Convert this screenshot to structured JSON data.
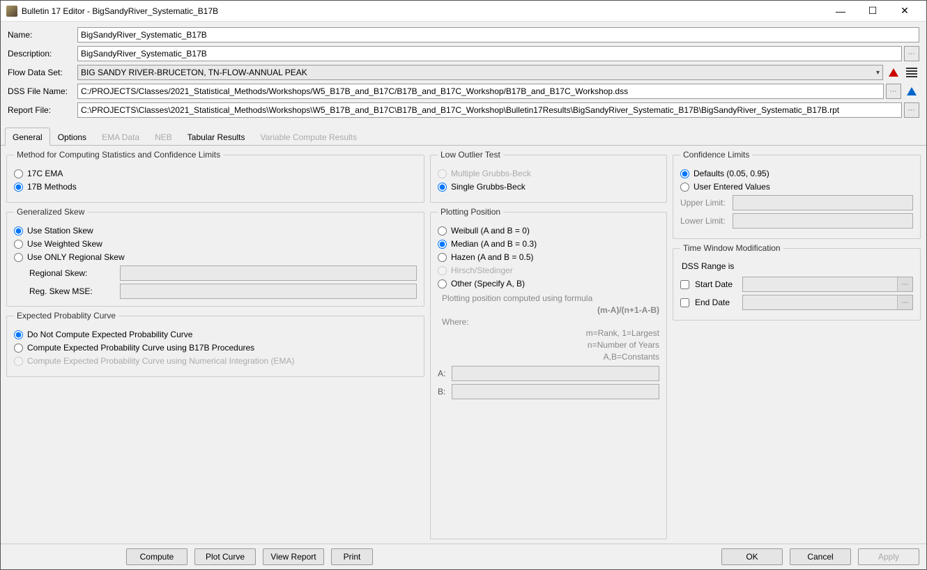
{
  "window": {
    "title": "Bulletin 17 Editor - BigSandyRiver_Systematic_B17B"
  },
  "form": {
    "nameLabel": "Name:",
    "name": "BigSandyRiver_Systematic_B17B",
    "descLabel": "Description:",
    "desc": "BigSandyRiver_Systematic_B17B",
    "flowLabel": "Flow Data Set:",
    "flow": "BIG SANDY RIVER-BRUCETON, TN-FLOW-ANNUAL PEAK",
    "dssLabel": "DSS File Name:",
    "dss": "C:/PROJECTS/Classes/2021_Statistical_Methods/Workshops/W5_B17B_and_B17C/B17B_and_B17C_Workshop/B17B_and_B17C_Workshop.dss",
    "reportLabel": "Report File:",
    "report": "C:\\PROJECTS\\Classes\\2021_Statistical_Methods\\Workshops\\W5_B17B_and_B17C\\B17B_and_B17C_Workshop\\Bulletin17Results\\BigSandyRiver_Systematic_B17B\\BigSandyRiver_Systematic_B17B.rpt"
  },
  "tabs": {
    "general": "General",
    "options": "Options",
    "ema": "EMA Data",
    "neb": "NEB",
    "tabular": "Tabular Results",
    "variable": "Variable Compute Results"
  },
  "methodGroup": {
    "legend": "Method for Computing Statistics and Confidence Limits",
    "opt17c": "17C EMA",
    "opt17b": "17B Methods"
  },
  "skewGroup": {
    "legend": "Generalized Skew",
    "station": "Use Station Skew",
    "weighted": "Use Weighted Skew",
    "regional": "Use ONLY Regional Skew",
    "regSkewLabel": "Regional Skew:",
    "regMSELabel": "Reg. Skew MSE:"
  },
  "expGroup": {
    "legend": "Expected Probablity Curve",
    "none": "Do Not Compute Expected Probability Curve",
    "b17b": "Compute Expected Probability Curve using B17B Procedures",
    "ema": "Compute Expected Probability Curve using Numerical Integration (EMA)"
  },
  "lowOutlier": {
    "legend": "Low Outlier Test",
    "multi": "Multiple Grubbs-Beck",
    "single": "Single Grubbs-Beck"
  },
  "plotPos": {
    "legend": "Plotting Position",
    "weibull": "Weibull (A and B = 0)",
    "median": "Median (A and B = 0.3)",
    "hazen": "Hazen (A and B = 0.5)",
    "hirsch": "Hirsch/Stedinger",
    "other": "Other (Specify A, B)",
    "info1": "Plotting position computed using formula",
    "formula": "(m-A)/(n+1-A-B)",
    "where": "Where:",
    "rank": "m=Rank, 1=Largest",
    "nline": "n=Number of Years",
    "abline": "A,B=Constants",
    "aLabel": "A:",
    "bLabel": "B:"
  },
  "conf": {
    "legend": "Confidence Limits",
    "defaults": "Defaults (0.05, 0.95)",
    "user": "User Entered Values",
    "upper": "Upper Limit:",
    "lower": "Lower Limit:"
  },
  "timeWin": {
    "legend": "Time Window Modification",
    "range": "DSS Range is",
    "start": "Start Date",
    "end": "End Date"
  },
  "buttons": {
    "compute": "Compute",
    "plot": "Plot Curve",
    "view": "View Report",
    "print": "Print",
    "ok": "OK",
    "cancel": "Cancel",
    "apply": "Apply"
  }
}
